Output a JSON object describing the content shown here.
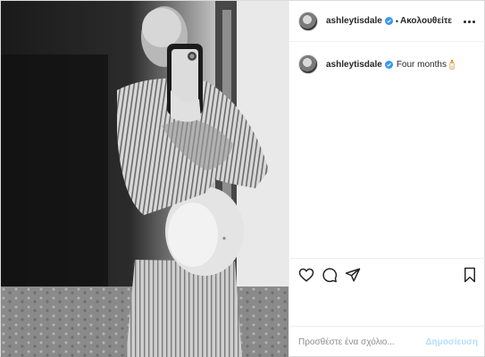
{
  "header": {
    "username": "ashleytisdale",
    "separator": "•",
    "follow_label": "Ακολουθείτε",
    "more_icon": "more-horizontal-icon"
  },
  "caption": {
    "username": "ashleytisdale",
    "text": "Four months",
    "emoji_icon": "baby-bottle-icon"
  },
  "actions": {
    "like_icon": "heart-icon",
    "comment_icon": "comment-icon",
    "share_icon": "paper-plane-icon",
    "save_icon": "bookmark-icon"
  },
  "comment_bar": {
    "placeholder": "Προσθέστε ένα σχόλιο...",
    "post_label": "Δημοσίευση"
  },
  "colors": {
    "verified_badge": "#3897f0",
    "post_button_disabled": "#b2dffc",
    "text": "#262626",
    "placeholder": "#8e8e8e"
  }
}
